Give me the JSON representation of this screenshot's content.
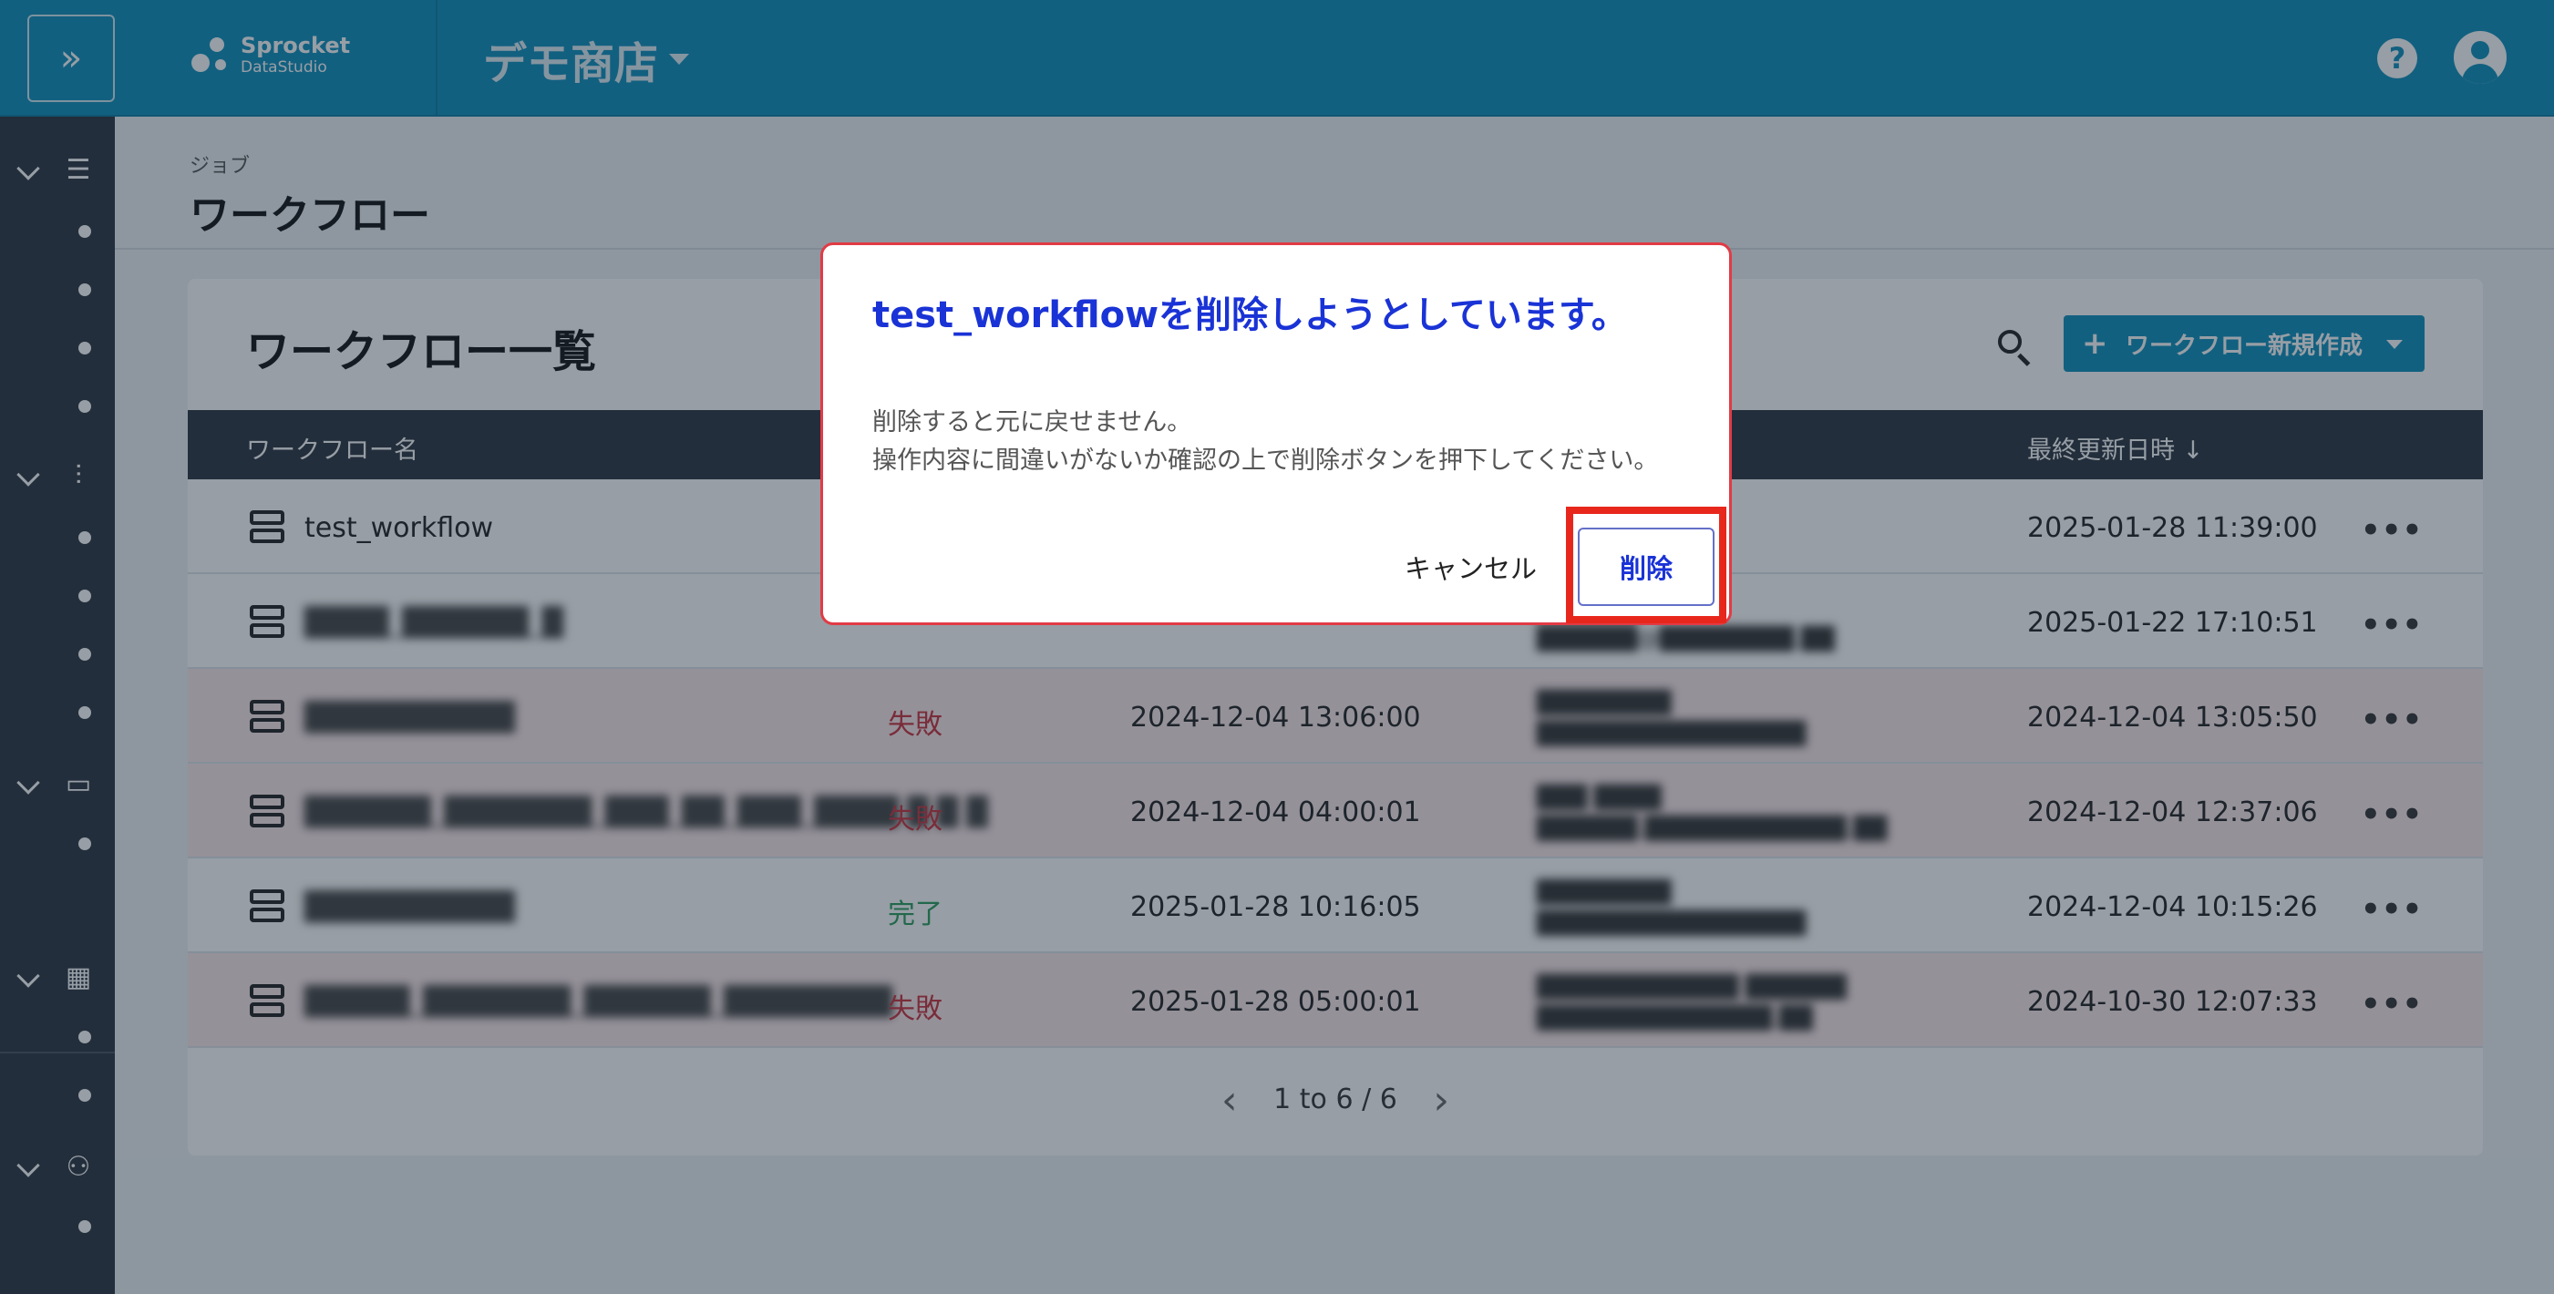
{
  "header": {
    "expand_icon": "»",
    "logo_line1": "Sprocket",
    "logo_line2": "DataStudio",
    "shop_name": "デモ商店",
    "help_icon": "?"
  },
  "page": {
    "breadcrumb": "ジョブ",
    "title": "ワークフロー"
  },
  "card": {
    "title": "ワークフロー一覧",
    "create_button": {
      "icon": "+",
      "label": "ワークフロー新規作成"
    }
  },
  "table": {
    "headers": {
      "name": "ワークフロー名",
      "updated": "最終更新日時 ↓"
    },
    "rows": [
      {
        "name": "test_workflow",
        "status": "",
        "executed": "",
        "user1": "",
        "user2": "",
        "updated": "2025-01-28 11:39:00",
        "state": "normal"
      },
      {
        "name": "████_██████_█",
        "status": "",
        "executed": "",
        "user1": "██████",
        "user2": "██████@████████.██",
        "updated": "2025-01-22 17:10:51",
        "state": "normal"
      },
      {
        "name": "██████████",
        "status": "失敗",
        "executed": "2024-12-04 13:06:00",
        "user1": "████████",
        "user2": "████████████████",
        "updated": "2024-12-04 13:05:50",
        "state": "fail"
      },
      {
        "name": "██████_███████_███_██_███_████ █ █ █",
        "status": "失敗",
        "executed": "2024-12-04 04:00:01",
        "user1": "███ ████",
        "user2": "██████.████████████.██",
        "updated": "2024-12-04 12:37:06",
        "state": "fail"
      },
      {
        "name": "██████████",
        "status": "完了",
        "executed": "2025-01-28 10:16:05",
        "user1": "████████",
        "user2": "████████████████",
        "updated": "2024-12-04 10:15:26",
        "state": "normal"
      },
      {
        "name": "█████_███████_██████_████████",
        "status": "失敗",
        "executed": "2025-01-28 05:00:01",
        "user1": "████████████ ██████",
        "user2": "██████████████.██",
        "updated": "2024-10-30 12:07:33",
        "state": "fail"
      }
    ],
    "more_icon": "•••"
  },
  "pagination": {
    "prev": "‹",
    "text": "1 to 6 / 6",
    "next": "›"
  },
  "dialog": {
    "title": "test_workflowを削除しようとしています。",
    "body_line1": "削除すると元に戻せません。",
    "body_line2": "操作内容に間違いがないか確認の上で削除ボタンを押下してください。",
    "cancel_label": "キャンセル",
    "delete_label": "削除"
  },
  "colors": {
    "header": "#0e8fbc",
    "sidebar": "#2c3440",
    "dialog_title": "#1a33d6",
    "highlight": "#e8271c",
    "fail_row": "#fce8ea"
  }
}
